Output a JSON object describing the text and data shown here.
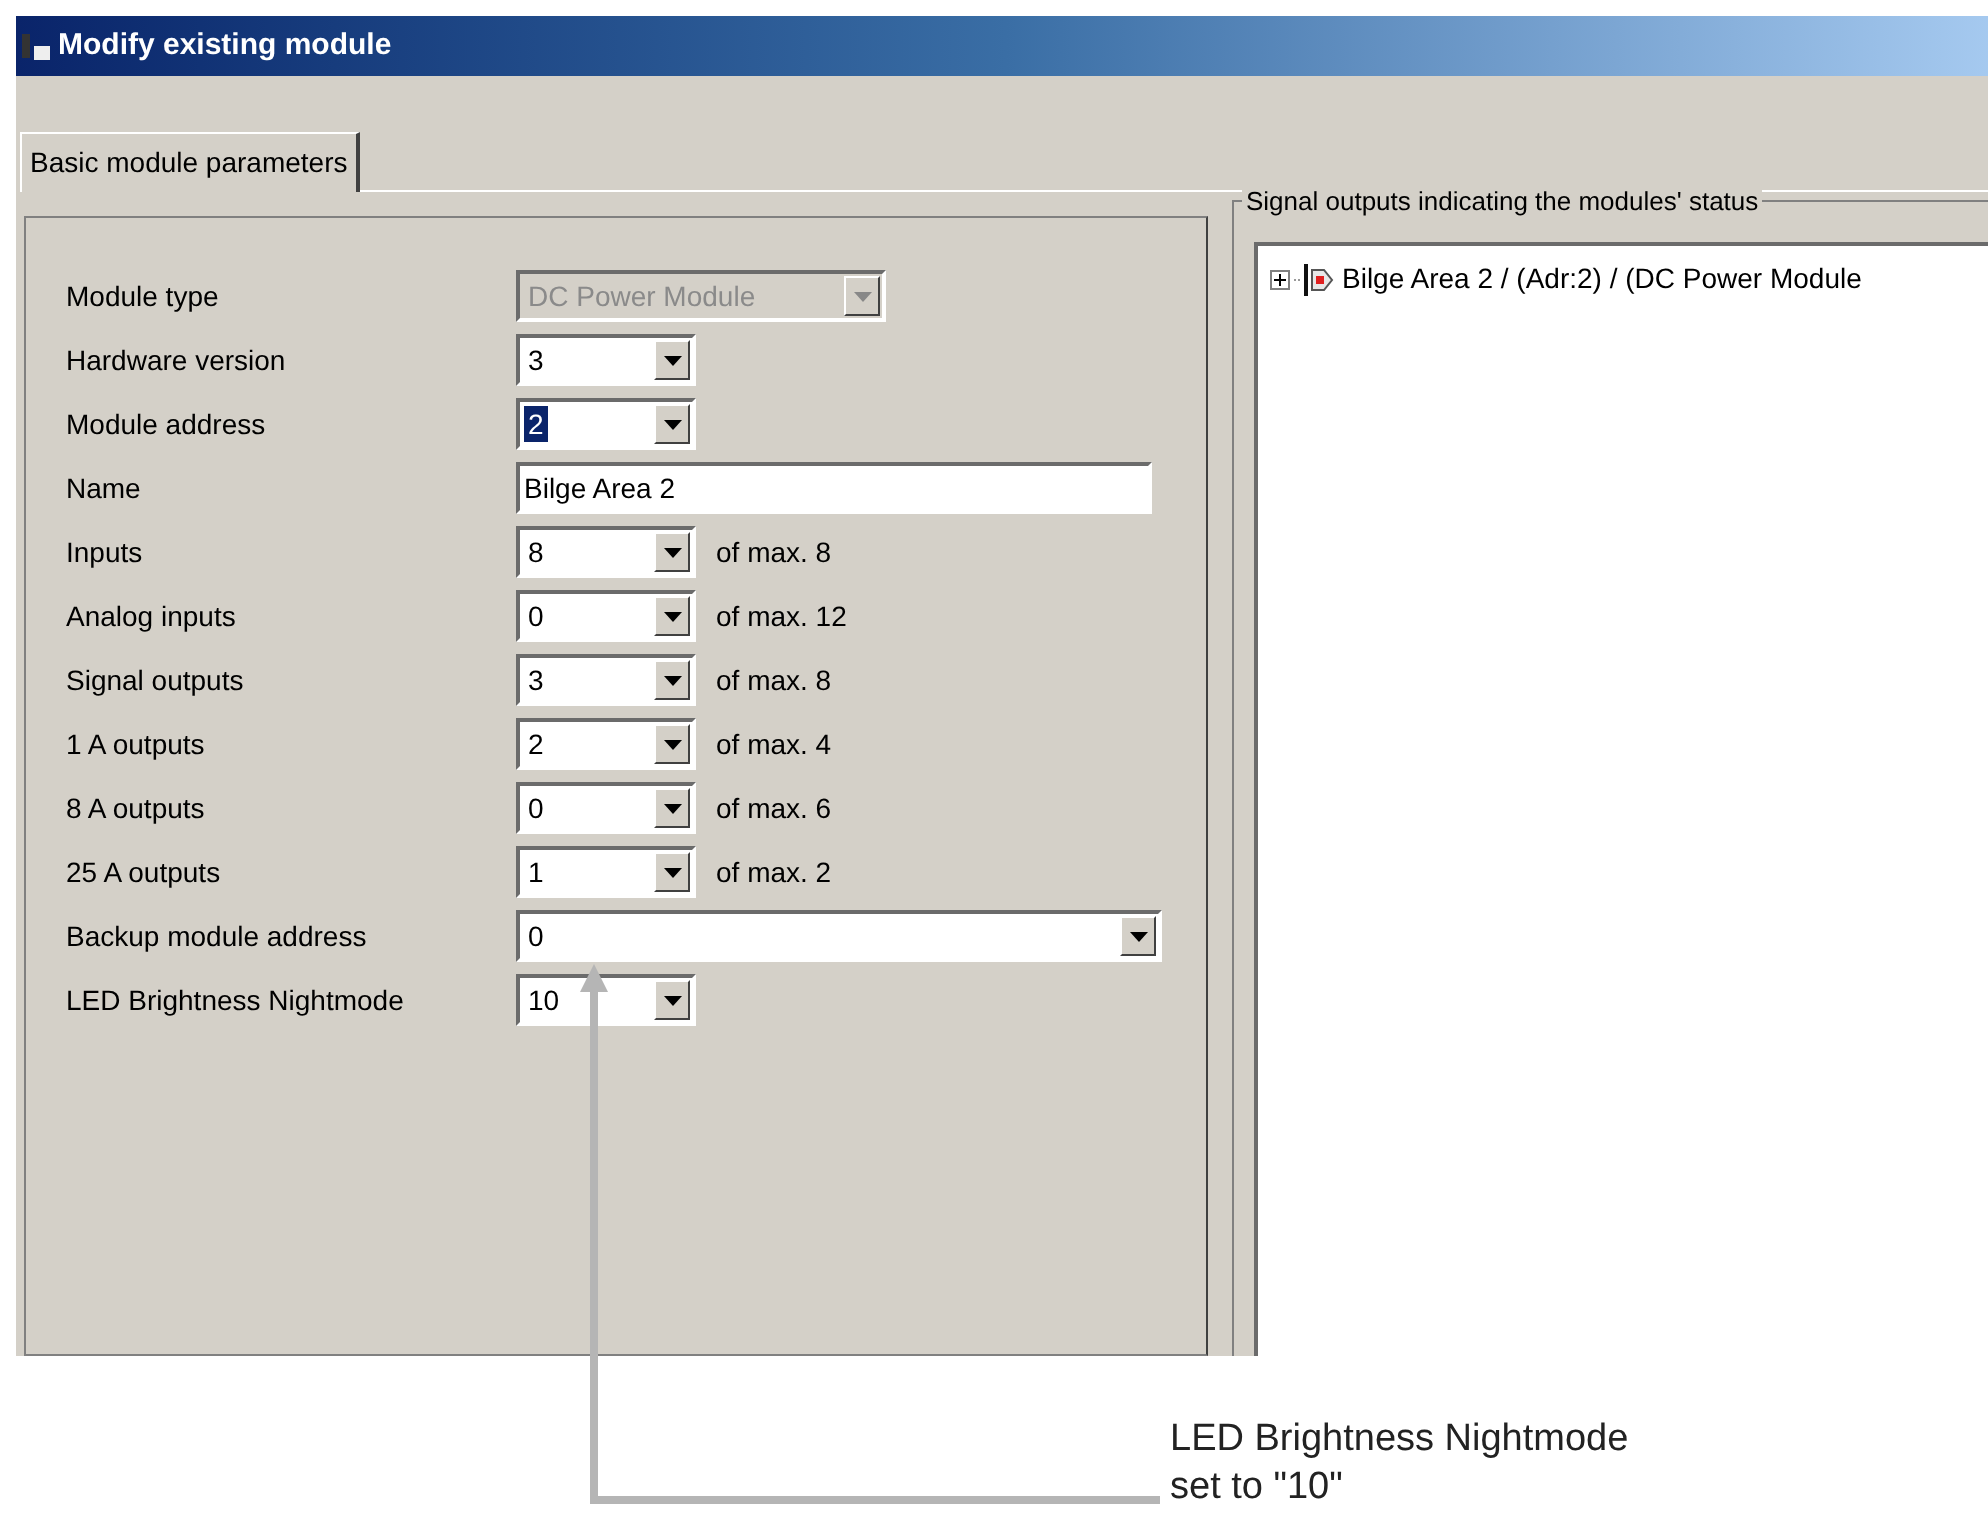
{
  "window": {
    "title": "Modify existing module"
  },
  "tabs": [
    {
      "label": "Basic module parameters",
      "selected": true
    }
  ],
  "fields": [
    {
      "label": "Module type",
      "kind": "wide_combo",
      "value": "DC Power Module",
      "disabled": true,
      "focused": false
    },
    {
      "label": "Hardware version",
      "kind": "combo",
      "value": "3",
      "disabled": false,
      "focused": false
    },
    {
      "label": "Module address",
      "kind": "combo",
      "value": "2",
      "disabled": false,
      "focused": true
    },
    {
      "label": "Name",
      "kind": "text",
      "value": "Bilge Area 2"
    },
    {
      "label": "Inputs",
      "kind": "combo",
      "value": "8",
      "disabled": false,
      "focused": false,
      "suffix": "of max. 8"
    },
    {
      "label": "Analog inputs",
      "kind": "combo",
      "value": "0",
      "disabled": false,
      "focused": false,
      "suffix": "of max. 12"
    },
    {
      "label": "Signal outputs",
      "kind": "combo",
      "value": "3",
      "disabled": false,
      "focused": false,
      "suffix": "of max. 8"
    },
    {
      "label": "1 A outputs",
      "kind": "combo",
      "value": "2",
      "disabled": false,
      "focused": false,
      "suffix": "of max. 4"
    },
    {
      "label": "8 A outputs",
      "kind": "combo",
      "value": "0",
      "disabled": false,
      "focused": false,
      "suffix": "of max. 6"
    },
    {
      "label": "25 A outputs",
      "kind": "combo",
      "value": "1",
      "disabled": false,
      "focused": false,
      "suffix": "of max. 2"
    },
    {
      "label": "Backup module address",
      "kind": "long_combo",
      "value": "0",
      "disabled": false,
      "focused": false
    },
    {
      "label": "LED Brightness Nightmode",
      "kind": "combo",
      "value": "10",
      "disabled": false,
      "focused": false
    }
  ],
  "signal_outputs": {
    "title": "Signal outputs indicating the modules' status",
    "tree": [
      {
        "label": "Bilge Area 2 / (Adr:2) / (DC Power Module",
        "expanded": false
      }
    ]
  },
  "annotation": {
    "lines": [
      "LED Brightness Nightmode",
      "set to \"10\""
    ]
  }
}
